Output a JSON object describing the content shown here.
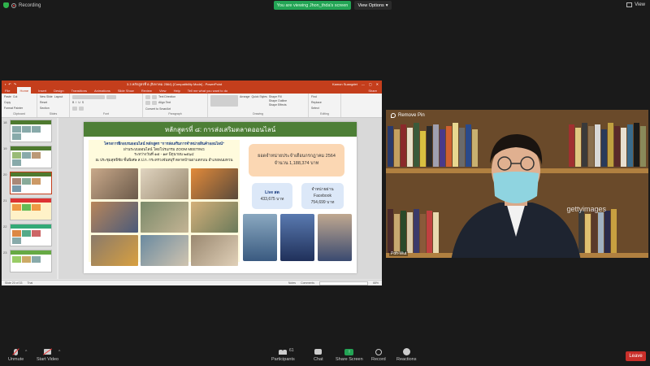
{
  "topbar": {
    "recording_label": "Recording",
    "viewing_banner": "You are viewing Jhon_thda's screen",
    "view_options_label": "View Options",
    "view_label": "View"
  },
  "ppt": {
    "window_title": "3.3 หลักสูตรที่ 8 (สิงหาคม 2564) [Compatibility Mode] - PowerPoint",
    "account_name": "Kamon Suangdet",
    "tabs": [
      "File",
      "Home",
      "Insert",
      "Design",
      "Transitions",
      "Animations",
      "Slide Show",
      "Review",
      "View",
      "Help"
    ],
    "tell_me": "Tell me what you want to do",
    "share_label": "Share",
    "ribbon_groups": [
      "Clipboard",
      "Slides",
      "Font",
      "Paragraph",
      "Drawing",
      "Editing"
    ],
    "ribbon_items": {
      "paste": "Paste",
      "cut": "Cut",
      "copy": "Copy",
      "format_painter": "Format Painter",
      "new_slide": "New Slide",
      "layout": "Layout",
      "reset": "Reset",
      "section": "Section",
      "text_direction": "Text Direction",
      "align_text": "Align Text",
      "convert_smartart": "Convert to SmartArt",
      "arrange": "Arrange",
      "quick_styles": "Quick Styles",
      "shape_fill": "Shape Fill",
      "shape_outline": "Shape Outline",
      "shape_effects": "Shape Effects",
      "find": "Find",
      "replace": "Replace",
      "select": "Select"
    },
    "thumb_numbers": [
      "18",
      "19",
      "20",
      "21",
      "22",
      "23"
    ],
    "selected_thumb": "20",
    "status_left": "Slide 20 of 33",
    "status_lang": "Thai",
    "status_notes": "Notes",
    "status_comments": "Comments",
    "zoom": "68%"
  },
  "slide": {
    "heading": "หลักสูตรที่ ๘: การส่งเสริมตลาดออนไลน์",
    "left_lines": [
      "โครงการฝึกอบรมออนไลน์ หลักสูตร \"การส่งเสริมการจำหน่ายสินค้าออนไลน์\"",
      "ผ่านระบบออนไลน์ โดยโปรแกรม ZOOM MEETING",
      "ระหว่างวันที่ ๑๕ - ๑๙ มิถุนายน ๒๕๖๔",
      "ณ ประชุมสุทธิชัย ชั้นพิเศษ ส.ป.ก. กระทรวงจันทบุรี ตลาดบ้านผาแตกบน อำเภอพนมทวน"
    ],
    "sales_box": {
      "line1": "ยอดจำหน่ายประจำเดือนกรกฎาคม 2564",
      "line2": "จำนวน 1,188,374  บาท"
    },
    "live_box": {
      "title": "Live สด",
      "value": "433,675 บาท"
    },
    "facebook_box": {
      "title": "จำหน่ายผ่าน",
      "subtitle": "Facebook",
      "value": "754,699 บาท"
    }
  },
  "video": {
    "remove_pin_label": "Remove Pin",
    "watermark": "gettyimages",
    "participant_name": "Poh-Wut"
  },
  "toolbar": {
    "unmute": "Unmute",
    "start_video": "Start Video",
    "participants": "Participants",
    "participants_count": "61",
    "chat": "Chat",
    "share_screen": "Share Screen",
    "record": "Record",
    "reactions": "Reactions",
    "leave": "Leave"
  },
  "colors": {
    "ppt_accent": "#c43e1c",
    "slide_header": "#4d7f36",
    "share_green": "#23a455",
    "leave_red": "#c92f2a"
  }
}
